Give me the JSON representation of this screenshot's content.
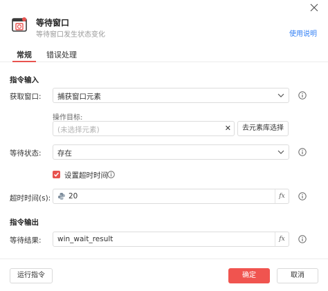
{
  "header": {
    "title": "等待窗口",
    "subtitle": "等待窗口发生状态变化",
    "help_link": "使用说明",
    "icon": "window-clock-icon"
  },
  "tabs": [
    {
      "label": "常规",
      "active": true
    },
    {
      "label": "错误处理",
      "active": false
    }
  ],
  "sections": {
    "input_title": "指令输入",
    "output_title": "指令输出"
  },
  "fields": {
    "get_window_label": "获取窗口:",
    "get_window_value": "捕获窗口元素",
    "op_target_label": "操作目标:",
    "op_target_placeholder": "(未选择元素)",
    "clear_symbol": "✕",
    "lib_select_label": "去元素库选择",
    "wait_state_label": "等待状态:",
    "wait_state_value": "存在",
    "timeout_checkbox_label": "设置超时时间",
    "timeout_checked": true,
    "timeout_label": "超时时间(s):",
    "timeout_value": "20",
    "result_label": "等待结果:",
    "result_value": "win_wait_result",
    "fx_symbol": "fx"
  },
  "footer": {
    "run_label": "运行指令",
    "ok_label": "确定",
    "cancel_label": "取消"
  },
  "colors": {
    "accent": "#f0544f",
    "link": "#2f7ef5"
  }
}
